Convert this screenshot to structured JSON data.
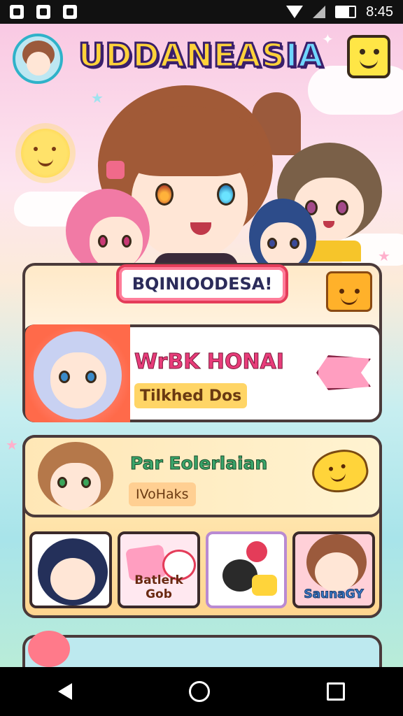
{
  "status_bar": {
    "time": "8:45"
  },
  "header": {
    "title_main": "UDDANEAS",
    "title_accent": "IA"
  },
  "banner": {
    "label": "BQINIOODESA!"
  },
  "featured_row": {
    "name": "WrBK HONAI",
    "tag": "Tilkhed Dos"
  },
  "sub_card": {
    "name": "Par Eolerlaian",
    "tag": "IVoHaks"
  },
  "tiles": [
    {
      "label": ""
    },
    {
      "label": "Batlerk Gob"
    },
    {
      "label": ""
    },
    {
      "label": "SaunaGY"
    }
  ],
  "colors": {
    "title_fill": "#ffd23a",
    "title_outline": "#3a1f6b",
    "accent": "#6fd6ff",
    "banner_border": "#e43c59"
  }
}
